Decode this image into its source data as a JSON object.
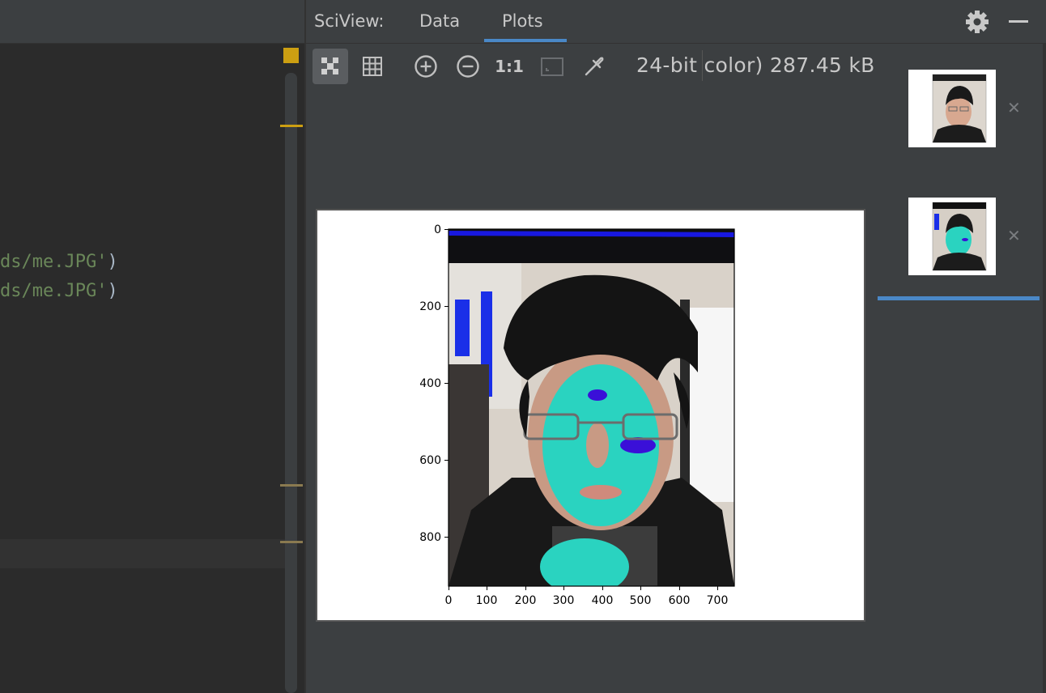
{
  "editor": {
    "code_lines": [
      {
        "str": "ds/me.JPG'",
        "paren": ")"
      },
      {
        "str": "ds/me.JPG'",
        "paren": ")"
      }
    ],
    "colors": {
      "string": "#6a8759",
      "warning": "#cc9f12"
    }
  },
  "sciview": {
    "title": "SciView:",
    "tabs": [
      {
        "label": "Data",
        "active": false
      },
      {
        "label": "Plots",
        "active": true
      }
    ],
    "toolbar": {
      "buttons": [
        {
          "name": "chessboard",
          "icon": "checkerboard-icon",
          "active": true
        },
        {
          "name": "grid",
          "icon": "grid-icon",
          "active": false
        },
        {
          "name": "zoom-in",
          "icon": "zoom-in-icon",
          "active": false
        },
        {
          "name": "zoom-out",
          "icon": "zoom-out-icon",
          "active": false
        },
        {
          "name": "actual-size",
          "icon": "actual-size-icon",
          "label": "1:1",
          "active": false
        },
        {
          "name": "fit-zoom",
          "icon": "fit-zoom-icon",
          "active": false
        },
        {
          "name": "color-picker",
          "icon": "eyedropper-icon",
          "active": false
        }
      ],
      "image_info": "24-bit color) 287.45 kB"
    },
    "plot": {
      "y_ticks": [
        "0",
        "200",
        "400",
        "600",
        "800"
      ],
      "x_ticks": [
        "0",
        "100",
        "200",
        "300",
        "400",
        "500",
        "600",
        "700"
      ]
    },
    "thumbnails": [
      {
        "name": "original-photo",
        "selected": false
      },
      {
        "name": "processed-photo",
        "selected": true
      }
    ],
    "colors": {
      "accent": "#4a88c7",
      "highlight": "#2ad3c0"
    }
  }
}
